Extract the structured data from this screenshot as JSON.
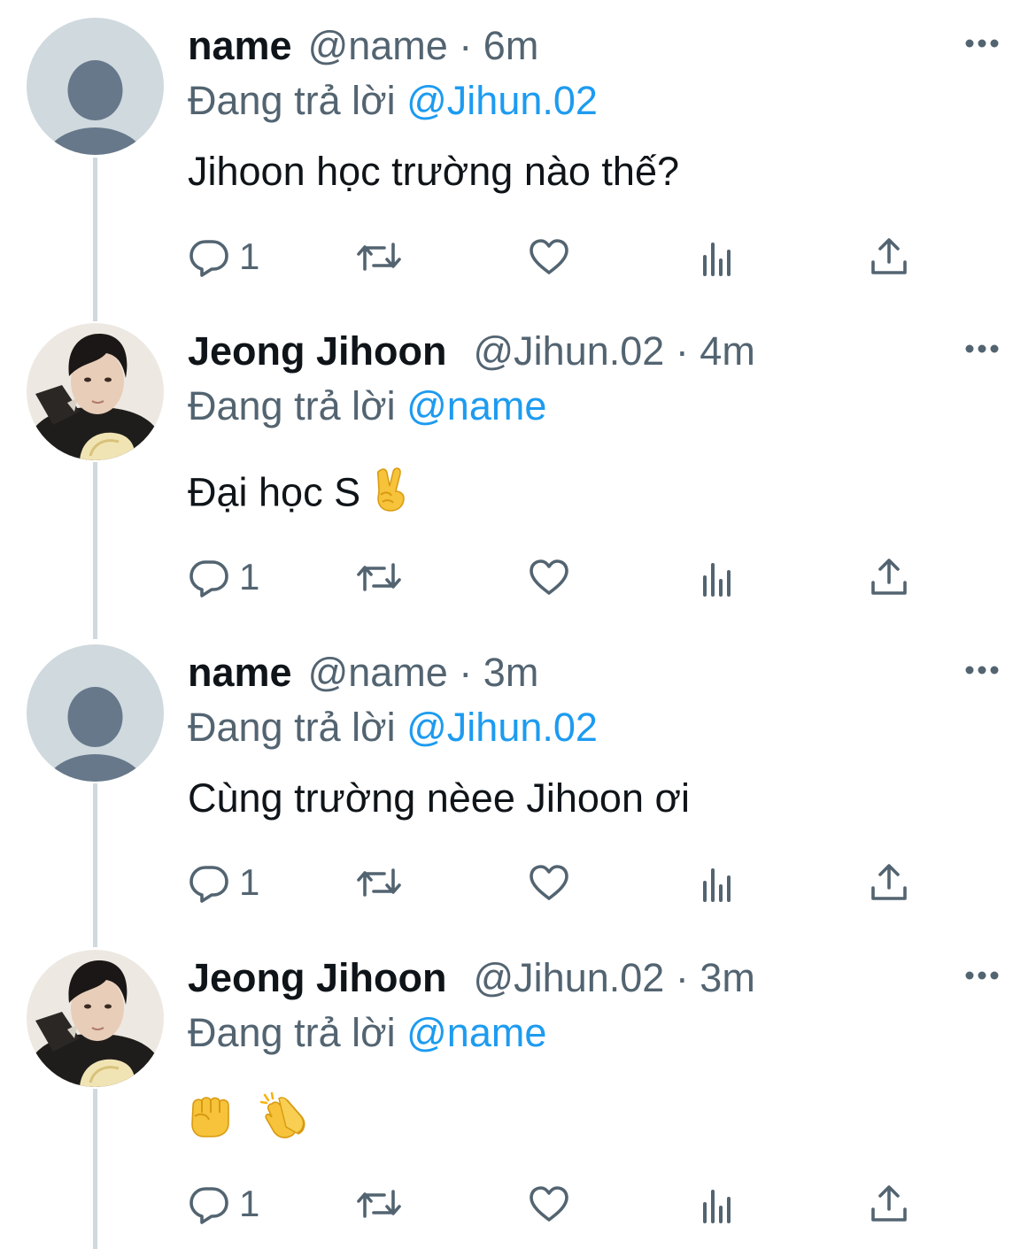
{
  "thread": [
    {
      "display_name": "name",
      "handle_time": "@name · 6m",
      "reply_prefix": "Đang trả lời",
      "reply_mention": "@Jihun.02",
      "text": "Jihoon học trường nào thế?",
      "reply_count": "1",
      "avatar": "default-avatar-icon"
    },
    {
      "display_name": "Jeong Jihoon",
      "handle_time": "@Jihun.02 · 4m",
      "reply_prefix": "Đang trả lời",
      "reply_mention": "@name",
      "text": "Đại học S",
      "emojis": [
        "victory-hand-emoji"
      ],
      "reply_count": "1",
      "avatar": "profile-photo"
    },
    {
      "display_name": "name",
      "handle_time": "@name · 3m",
      "reply_prefix": "Đang trả lời",
      "reply_mention": "@Jihun.02",
      "text": "Cùng trường nèee Jihoon ơi",
      "reply_count": "1",
      "avatar": "default-avatar-icon"
    },
    {
      "display_name": "Jeong Jihoon",
      "handle_time": "@Jihun.02 · 3m",
      "reply_prefix": "Đang trả lời",
      "reply_mention": "@name",
      "text": "",
      "emojis": [
        "oncoming-fist-emoji",
        "clapping-hands-emoji"
      ],
      "reply_count": "1",
      "avatar": "profile-photo"
    }
  ],
  "icons": {
    "reply": "reply-icon",
    "retweet": "retweet-icon",
    "like": "heart-icon",
    "views": "views-icon",
    "share": "share-icon",
    "more": "more-icon"
  },
  "colors": {
    "text": "#0f1419",
    "secondary": "#536471",
    "mention": "#1d9bf0",
    "thread_line": "#cfd9de",
    "default_avatar_bg": "#cfd9de",
    "default_avatar_fg": "#66788a"
  }
}
